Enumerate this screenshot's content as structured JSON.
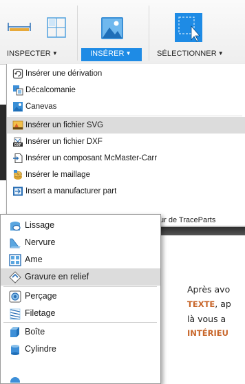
{
  "toolbar": {
    "inspect": {
      "label": "INSPECTER",
      "icon": "measure-icon"
    },
    "insert": {
      "label": "INSÉRER",
      "icon": "insert-image-icon",
      "active_color": "#1e8be5"
    },
    "select": {
      "label": "SÉLECTIONNER",
      "icon": "select-cursor-icon"
    },
    "dropdown_arrow": "▼"
  },
  "insert_menu": {
    "items": [
      {
        "label": "Insérer une dérivation",
        "icon": "derive-icon"
      },
      {
        "label": "Décalcomanie",
        "icon": "decal-icon"
      },
      {
        "label": "Canevas",
        "icon": "canvas-icon"
      },
      {
        "label": "Insérer un fichier SVG",
        "icon": "svg-file-icon",
        "highlighted": true
      },
      {
        "label": "Insérer un fichier DXF",
        "icon": "dxf-file-icon"
      },
      {
        "label": "Insérer un composant McMaster-Carr",
        "icon": "mcmaster-icon"
      },
      {
        "label": "Insérer le maillage",
        "icon": "mesh-icon"
      },
      {
        "label": "Insert a manufacturer part",
        "icon": "manufacturer-part-icon"
      }
    ],
    "partial_item": "ur de TraceParts"
  },
  "create_menu": {
    "items": [
      {
        "label": "Lissage",
        "icon": "loft-icon"
      },
      {
        "label": "Nervure",
        "icon": "rib-icon"
      },
      {
        "label": "Ame",
        "icon": "web-icon"
      },
      {
        "label": "Gravure en relief",
        "icon": "emboss-icon",
        "highlighted": true
      },
      {
        "label": "Perçage",
        "icon": "hole-icon"
      },
      {
        "label": "Filetage",
        "icon": "thread-icon"
      },
      {
        "label": "Boîte",
        "icon": "box-icon"
      },
      {
        "label": "Cylindre",
        "icon": "cylinder-icon"
      }
    ]
  },
  "background_text": {
    "line1": "Après avo",
    "line2_bold": "TEXTE",
    "line2_rest": ", ap",
    "line3": "là vous a",
    "line4_bold": "INTÉRIEU"
  }
}
